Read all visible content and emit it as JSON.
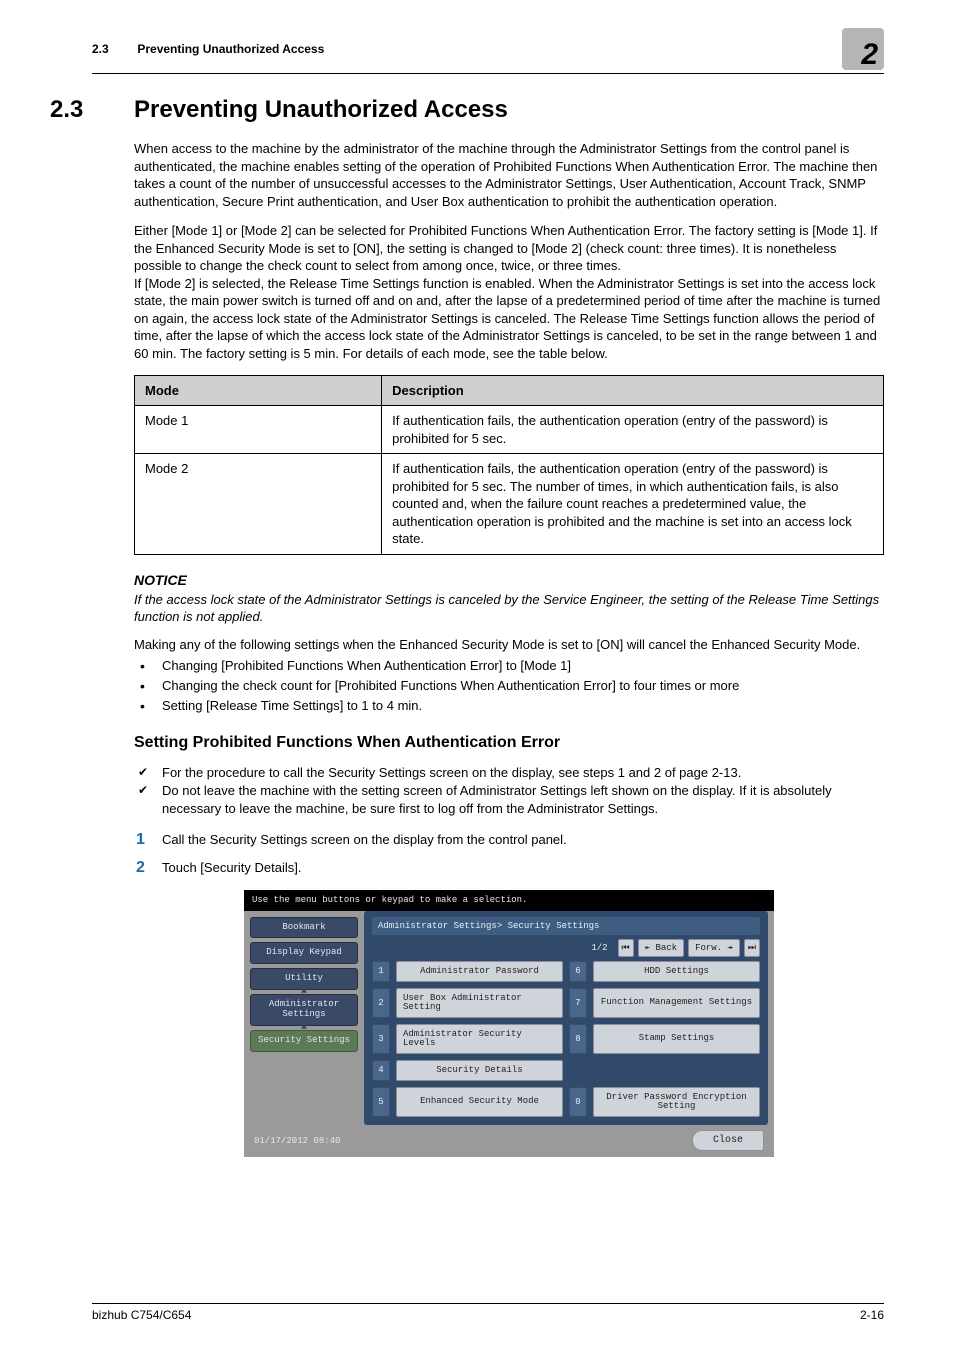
{
  "running_head": {
    "section": "2.3",
    "title": "Preventing Unauthorized Access",
    "chapter": "2"
  },
  "heading": {
    "num": "2.3",
    "title": "Preventing Unauthorized Access"
  },
  "paragraphs": {
    "intro": "When access to the machine by the administrator of the machine through the Administrator Settings from the control panel is authenticated, the machine enables setting of the operation of Prohibited Functions When Authentication Error. The machine then takes a count of the number of unsuccessful accesses to the Administrator Settings, User Authentication, Account Track, SNMP authentication, Secure Print authentication, and User Box authentication to prohibit the authentication operation.",
    "mode_select": "Either [Mode 1] or [Mode 2] can be selected for Prohibited Functions When Authentication Error. The factory setting is [Mode 1]. If the Enhanced Security Mode is set to [ON], the setting is changed to [Mode 2] (check count: three times). It is nonetheless possible to change the check count to select from among once, twice, or three times.",
    "mode2_detail": "If [Mode 2] is selected, the Release Time Settings function is enabled. When the Administrator Settings is set into the access lock state, the main power switch is turned off and on and, after the lapse of a predetermined period of time after the machine is turned on again, the access lock state of the Administrator Settings is canceled. The Release Time Settings function allows the period of time, after the lapse of which the access lock state of the Administrator Settings is canceled, to be set in the range between 1 and 60 min. The factory setting is 5 min. For details of each mode, see the table below."
  },
  "mode_table": {
    "headers": {
      "mode": "Mode",
      "desc": "Description"
    },
    "rows": [
      {
        "mode": "Mode 1",
        "desc": "If authentication fails, the authentication operation (entry of the password) is prohibited for 5 sec."
      },
      {
        "mode": "Mode 2",
        "desc": "If authentication fails, the authentication operation (entry of the password) is prohibited for 5 sec. The number of times, in which authentication fails, is also counted and, when the failure count reaches a predetermined value, the authentication operation is prohibited and the machine is set into an access lock state."
      }
    ]
  },
  "notice": {
    "label": "NOTICE",
    "text": "If the access lock state of the Administrator Settings is canceled by the Service Engineer, the setting of the Release Time Settings function is not applied."
  },
  "cancel_intro": "Making any of the following settings when the Enhanced Security Mode is set to [ON] will cancel the Enhanced Security Mode.",
  "cancel_bullets": [
    "Changing [Prohibited Functions When Authentication Error] to [Mode 1]",
    "Changing the check count for [Prohibited Functions When Authentication Error] to four times or more",
    "Setting [Release Time Settings] to 1 to 4 min."
  ],
  "subheading": "Setting Prohibited Functions When Authentication Error",
  "prereqs": [
    "For the procedure to call the Security Settings screen on the display, see steps 1 and 2 of page 2-13.",
    "Do not leave the machine with the setting screen of Administrator Settings left shown on the display. If it is absolutely necessary to leave the machine, be sure first to log off from the Administrator Settings."
  ],
  "steps": [
    "Call the Security Settings screen on the display from the control panel.",
    "Touch [Security Details]."
  ],
  "panel": {
    "hint": "Use the menu buttons or keypad to make a selection.",
    "sidebar": [
      "Bookmark",
      "Display Keypad",
      "Utility",
      "Administrator Settings",
      "Security Settings"
    ],
    "breadcrumb": "Administrator Settings> Security Settings",
    "page": "1/2",
    "nav": {
      "first": "⏮",
      "back": "↞ Back",
      "fwd": "Forw. ↠",
      "last": "⏭"
    },
    "items": [
      {
        "num": "1",
        "label": "Administrator Password"
      },
      {
        "num": "6",
        "label": "HDD Settings"
      },
      {
        "num": "2",
        "label": "User Box Administrator Setting"
      },
      {
        "num": "7",
        "label": "Function Management Settings"
      },
      {
        "num": "3",
        "label": "Administrator Security Levels"
      },
      {
        "num": "8",
        "label": "Stamp Settings"
      },
      {
        "num": "4",
        "label": "Security Details"
      },
      {
        "num": "",
        "label": ""
      },
      {
        "num": "5",
        "label": "Enhanced Security Mode"
      },
      {
        "num": "0",
        "label": "Driver Password Encryption Setting"
      }
    ],
    "datetime": "01/17/2012   08:40",
    "close": "Close"
  },
  "footer": {
    "left": "bizhub C754/C654",
    "right": "2-16"
  }
}
